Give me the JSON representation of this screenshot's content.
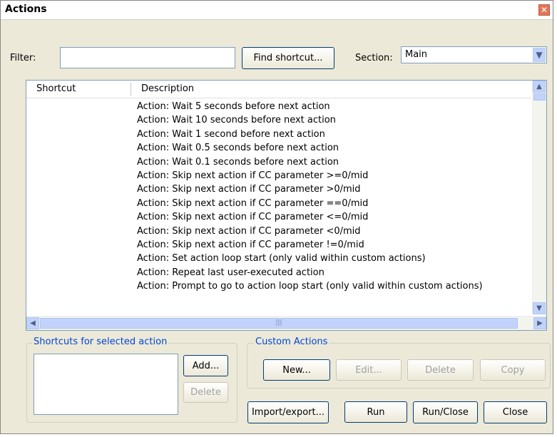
{
  "window": {
    "title": "Actions",
    "close_glyph": "✕"
  },
  "filter": {
    "label": "Filter:",
    "value": ""
  },
  "find_shortcut": {
    "label": "Find shortcut..."
  },
  "section": {
    "label": "Section:",
    "value": "Main"
  },
  "table": {
    "columns": [
      "Shortcut",
      "Description"
    ],
    "rows": [
      "Action: Wait 5 seconds before next action",
      "Action: Wait 10 seconds before next action",
      "Action: Wait 1 second before next action",
      "Action: Wait 0.5 seconds before next action",
      "Action: Wait 0.1 seconds before next action",
      "Action: Skip next action if CC parameter >=0/mid",
      "Action: Skip next action if CC parameter >0/mid",
      "Action: Skip next action if CC parameter ==0/mid",
      "Action: Skip next action if CC parameter <=0/mid",
      "Action: Skip next action if CC parameter <0/mid",
      "Action: Skip next action if CC parameter !=0/mid",
      "Action: Set action loop start (only valid within custom actions)",
      "Action: Repeat last user-executed action",
      "Action: Prompt to go to action loop start (only valid within custom actions)"
    ]
  },
  "shortcuts_group": {
    "label": "Shortcuts for selected action",
    "add": "Add...",
    "delete": "Delete"
  },
  "custom_group": {
    "label": "Custom Actions",
    "new": "New...",
    "edit": "Edit...",
    "delete": "Delete",
    "copy": "Copy"
  },
  "bottom": {
    "import_export": "Import/export...",
    "run": "Run",
    "run_close": "Run/Close",
    "close": "Close"
  },
  "colors": {
    "group_label": "#0046d5",
    "scroll": "#c1d3fb",
    "background": "#ece9d8"
  }
}
